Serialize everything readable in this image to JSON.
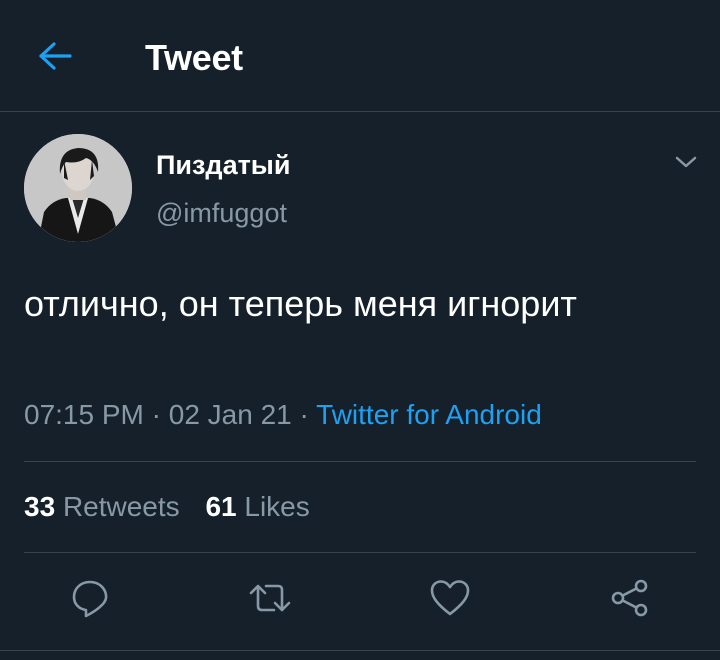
{
  "header": {
    "title": "Tweet",
    "back_icon": "arrow-left-icon"
  },
  "author": {
    "display_name": "Пиздатый",
    "handle": "@imfuggot"
  },
  "tweet": {
    "text": "отлично, он теперь меня игнорит",
    "time": "07:15 PM",
    "date": "02 Jan 21",
    "separator": "·",
    "source": "Twitter for Android"
  },
  "stats": {
    "retweets_count": "33",
    "retweets_label": "Retweets",
    "likes_count": "61",
    "likes_label": "Likes"
  },
  "actions": [
    "reply-icon",
    "retweet-icon",
    "like-icon",
    "share-icon"
  ],
  "colors": {
    "background": "#15202b",
    "accent": "#1da1f2",
    "secondary_text": "#8899a6",
    "divider": "#38444d"
  }
}
